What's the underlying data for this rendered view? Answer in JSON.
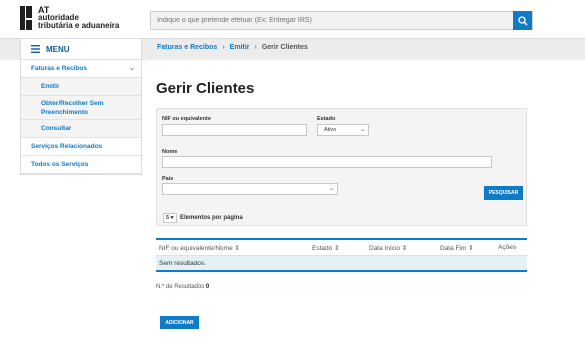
{
  "header": {
    "logo_at": "AT",
    "logo_line1": "autoridade",
    "logo_line2": "tributária e aduaneira",
    "search_placeholder": "Indique o que pretende efetuar (Ex: Entregar IRS)",
    "search_icon": "search-icon"
  },
  "nav": {
    "menu_label": "MENU",
    "breadcrumb": [
      "Faturas e Recibos",
      "Emitir",
      "Gerir Clientes"
    ]
  },
  "sidebar": {
    "items": [
      {
        "label": "Faturas e Recibos"
      },
      {
        "label": "Emitir"
      },
      {
        "label": "Obter/Recolher Sem Preenchimento"
      },
      {
        "label": "Consultar"
      },
      {
        "label": "Serviços Relacionados"
      },
      {
        "label": "Todos os Serviços"
      }
    ]
  },
  "main": {
    "title": "Gerir Clientes",
    "filters": {
      "nif_label": "NIF ou equivalente",
      "nif_value": "",
      "estado_label": "Estado",
      "estado_value": "Ativo",
      "nome_label": "Nome",
      "nome_value": "",
      "pais_label": "País",
      "pais_value": "",
      "search_button": "PESQUISAR",
      "per_page_value": "5",
      "per_page_label": "Elementos por página"
    },
    "table": {
      "columns": [
        "NIF ou equivalente/Nome",
        "Estado",
        "Data Início",
        "Data Fim",
        "Ações"
      ],
      "empty_message": "Sem resultados."
    },
    "results_label": "N.º de Resultados",
    "results_count": "0",
    "add_button": "ADICIONAR"
  },
  "colors": {
    "accent": "#0f7ac6",
    "row_bg": "#e6f1f5"
  }
}
